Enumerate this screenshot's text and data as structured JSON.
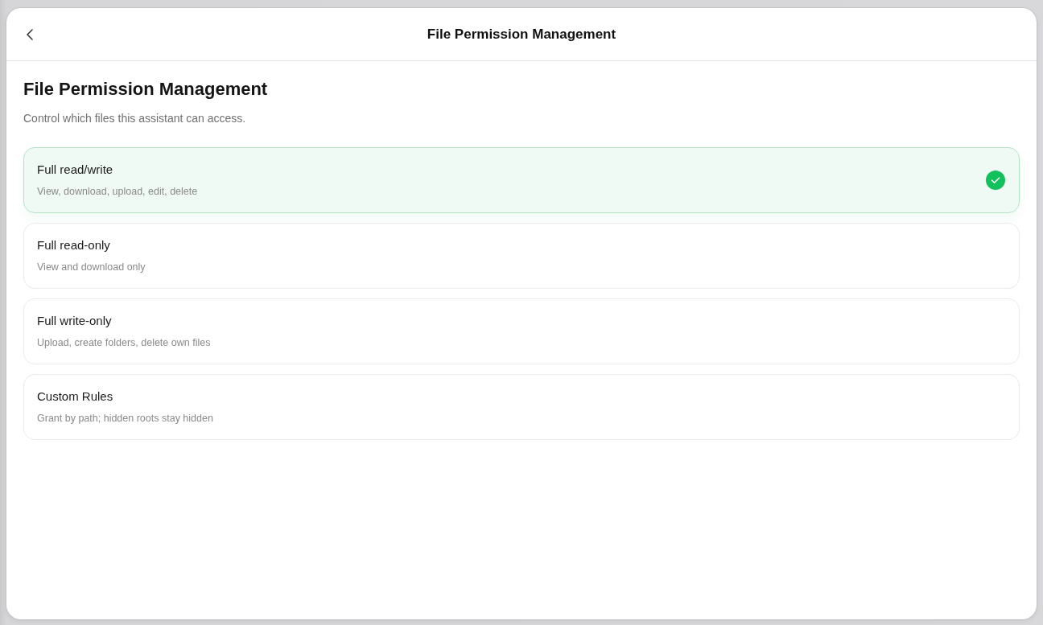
{
  "header": {
    "title": "File Permission Management"
  },
  "heading": "File Permission Management",
  "description": "Control which files this assistant can access.",
  "options": [
    {
      "title": "Full read/write",
      "description": "View, download, upload, edit, delete",
      "selected": true
    },
    {
      "title": "Full read-only",
      "description": "View and download only",
      "selected": false
    },
    {
      "title": "Full write-only",
      "description": "Upload, create folders, delete own files",
      "selected": false
    },
    {
      "title": "Custom Rules",
      "description": "Grant by path; hidden roots stay hidden",
      "selected": false
    }
  ]
}
